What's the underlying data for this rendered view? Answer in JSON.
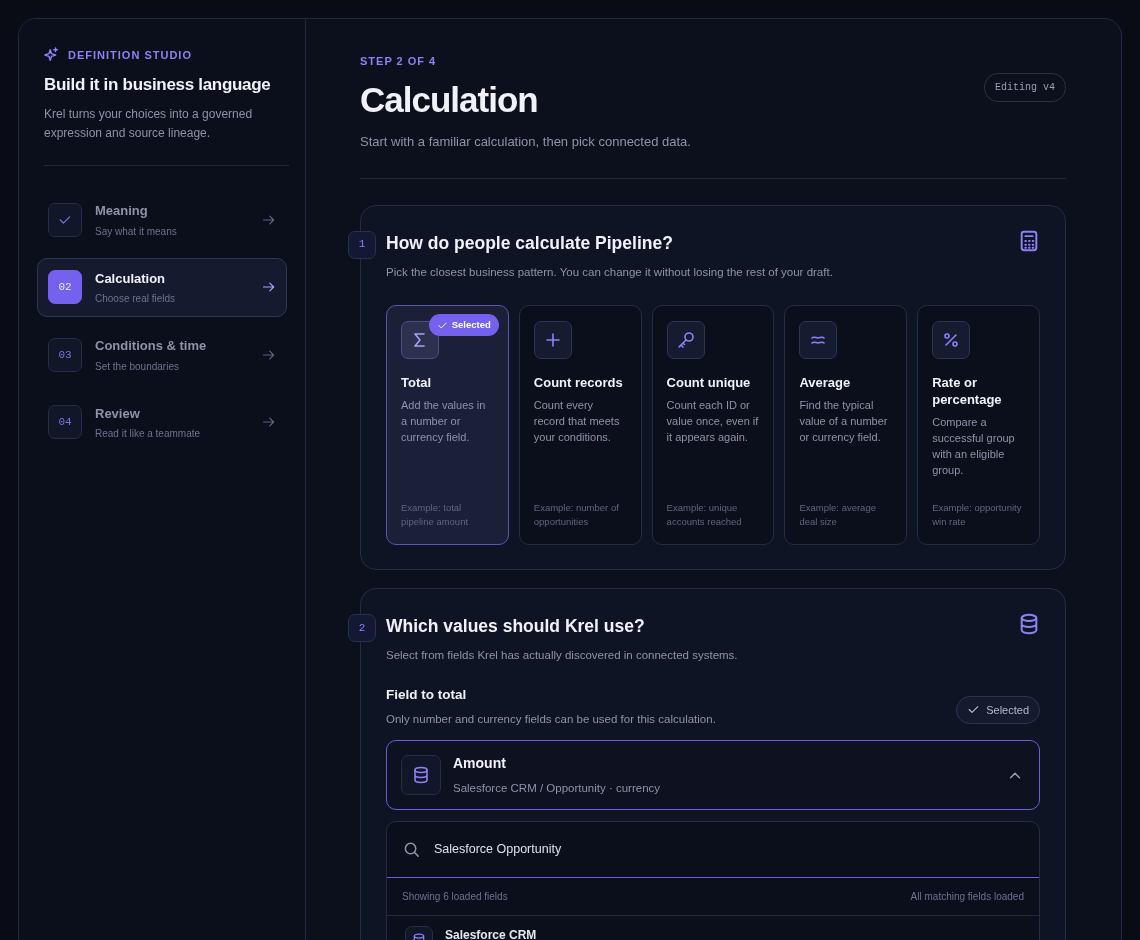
{
  "sidebar": {
    "eyebrow": "DEFINITION STUDIO",
    "title": "Build it in business language",
    "description": "Krel turns your choices into a governed expression and source lineage.",
    "steps": [
      {
        "title": "Meaning",
        "subtitle": "Say what it means",
        "completed": true,
        "selected": false
      },
      {
        "number": "02",
        "title": "Calculation",
        "subtitle": "Choose real fields",
        "completed": false,
        "selected": true
      },
      {
        "number": "03",
        "title": "Conditions & time",
        "subtitle": "Set the boundaries",
        "completed": false,
        "selected": false
      },
      {
        "number": "04",
        "title": "Review",
        "subtitle": "Read it like a teammate",
        "completed": false,
        "selected": false
      }
    ]
  },
  "header": {
    "step_label": "STEP 2 OF 4",
    "title": "Calculation",
    "subtitle": "Start with a familiar calculation, then pick connected data.",
    "version_badge": "Editing v4"
  },
  "sections": [
    {
      "number": "1",
      "title": "How do people calculate Pipeline?",
      "description": "Pick the closest business pattern. You can change it without losing the rest of your draft.",
      "kind": "patterns",
      "options": [
        {
          "kind": "sigma",
          "title": "Total",
          "description": "Add the values in a number or currency field.",
          "example": "Example: total pipeline amount",
          "selected": true,
          "badge": "Selected"
        },
        {
          "kind": "plus",
          "title": "Count records",
          "description": "Count every record that meets your conditions.",
          "example": "Example: number of opportunities",
          "selected": false
        },
        {
          "kind": "key",
          "title": "Count unique",
          "description": "Count each ID or value once, even if it appears again.",
          "example": "Example: unique accounts reached",
          "selected": false
        },
        {
          "kind": "approx",
          "title": "Average",
          "description": "Find the typical value of a number or currency field.",
          "example": "Example: average deal size",
          "selected": false
        },
        {
          "kind": "percent",
          "title": "Rate or percentage",
          "description": "Compare a successful group with an eligible group.",
          "example": "Example: opportunity win rate",
          "selected": false
        }
      ]
    },
    {
      "number": "2",
      "title": "Which values should Krel use?",
      "description": "Select from fields Krel has actually discovered in connected systems.",
      "kind": "fields",
      "field_label": "Field to total",
      "field_hint": "Only number and currency fields can be used for this calculation.",
      "status_badge": "Selected",
      "selected_field": {
        "name": "Amount",
        "path": "Salesforce CRM / Opportunity · currency",
        "expanded": true
      },
      "search": {
        "value": "Salesforce Opportunity"
      },
      "results_count": "Showing 6 loaded fields",
      "results_status": "All matching fields loaded",
      "results": [
        {
          "name": "Salesforce CRM"
        }
      ]
    }
  ]
}
